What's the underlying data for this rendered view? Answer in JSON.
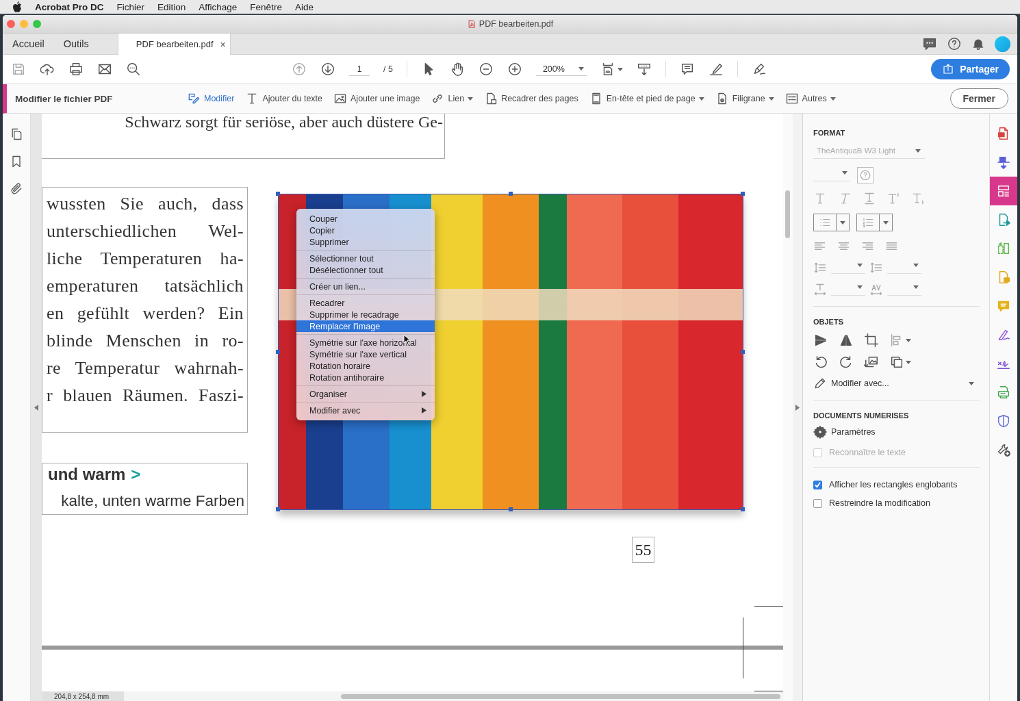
{
  "menubar": {
    "app": "Acrobat Pro DC",
    "items": [
      "Fichier",
      "Edition",
      "Affichage",
      "Fenêtre",
      "Aide"
    ]
  },
  "window": {
    "title": "PDF bearbeiten.pdf"
  },
  "tabs": [
    {
      "label": "Accueil",
      "selected": false
    },
    {
      "label": "Outils",
      "selected": false
    },
    {
      "label": "PDF bearbeiten.pdf",
      "selected": true,
      "close": "×"
    }
  ],
  "toolbar": {
    "page_current": "1",
    "page_total": "/ 5",
    "zoom": "200%",
    "share": "Partager"
  },
  "edit_bar": {
    "title": "Modifier le fichier PDF",
    "close": "Fermer",
    "tools": [
      {
        "label": "Modifier",
        "selected": true,
        "dropdown": false
      },
      {
        "label": "Ajouter du texte",
        "selected": false,
        "dropdown": false
      },
      {
        "label": "Ajouter une image",
        "selected": false,
        "dropdown": false
      },
      {
        "label": "Lien",
        "selected": false,
        "dropdown": true
      },
      {
        "label": "Recadrer des pages",
        "selected": false,
        "dropdown": false
      },
      {
        "label": "En-tête et pied de page",
        "selected": false,
        "dropdown": true
      },
      {
        "label": "Filigrane",
        "selected": false,
        "dropdown": true
      },
      {
        "label": "Autres",
        "selected": false,
        "dropdown": true
      }
    ]
  },
  "document": {
    "top_line": "Schwarz sorgt für seriöse, aber auch düstere Ge-",
    "paragraph_lines": [
      "wussten Sie auch, dass",
      "unterschiedlichen Wel-",
      "liche Temperaturen ha-",
      "emperaturen tatsächlich",
      "en gefühlt werden? Ein",
      "blinde Menschen in ro-",
      "re Temperatur wahrnah-",
      "r blauen Räumen. Faszi-"
    ],
    "heading": "und warm",
    "heading_arrow": ">",
    "subline": "kalte, unten warme Farben",
    "page_number": "55",
    "dimensions": "204,8 x 254,8 mm"
  },
  "context_menu": {
    "groups": [
      {
        "items": [
          {
            "label": "Couper",
            "selected": false,
            "submenu": false
          },
          {
            "label": "Copier",
            "selected": false,
            "submenu": false
          },
          {
            "label": "Supprimer",
            "selected": false,
            "submenu": false
          }
        ]
      },
      {
        "items": [
          {
            "label": "Sélectionner tout",
            "selected": false,
            "submenu": false
          },
          {
            "label": "Désélectionner tout",
            "selected": false,
            "submenu": false
          }
        ]
      },
      {
        "items": [
          {
            "label": "Créer un lien...",
            "selected": false,
            "submenu": false
          }
        ]
      },
      {
        "items": [
          {
            "label": "Recadrer",
            "selected": false,
            "submenu": false
          },
          {
            "label": "Supprimer le recadrage",
            "selected": false,
            "submenu": false
          },
          {
            "label": "Remplacer l'image",
            "selected": true,
            "submenu": false
          }
        ]
      },
      {
        "items": [
          {
            "label": "Symétrie sur l'axe horizontal",
            "selected": false,
            "submenu": false
          },
          {
            "label": "Symétrie sur l'axe vertical",
            "selected": false,
            "submenu": false
          },
          {
            "label": "Rotation horaire",
            "selected": false,
            "submenu": false
          },
          {
            "label": "Rotation antihoraire",
            "selected": false,
            "submenu": false
          }
        ]
      },
      {
        "items": [
          {
            "label": "Organiser",
            "selected": false,
            "submenu": true
          }
        ]
      },
      {
        "items": [
          {
            "label": "Modifier avec",
            "selected": false,
            "submenu": true
          }
        ]
      }
    ]
  },
  "format_panel": {
    "format_heading": "FORMAT",
    "font": "TheAntiquaB W3 Light",
    "objects_heading": "OBJETS",
    "edit_with": "Modifier avec...",
    "scanned_heading": "DOCUMENTS NUMERISES",
    "settings": "Paramètres",
    "checkboxes": [
      {
        "label": "Reconnaître le texte",
        "checked": false,
        "disabled": true
      },
      {
        "label": "Afficher les rectangles englobants",
        "checked": true,
        "disabled": false
      },
      {
        "label": "Restreindre la modification",
        "checked": false,
        "disabled": false
      }
    ]
  },
  "tool_rail": [
    {
      "selected": false,
      "color": "#d9433f"
    },
    {
      "selected": false,
      "color": "#5a5fd6"
    },
    {
      "selected": true,
      "color": "#d8388b"
    },
    {
      "selected": false,
      "color": "#1f9a9a"
    },
    {
      "selected": false,
      "color": "#5cb648"
    },
    {
      "selected": false,
      "color": "#e3a81c"
    },
    {
      "selected": false,
      "color": "#e3b21c"
    },
    {
      "selected": false,
      "color": "#8b55d6"
    },
    {
      "selected": false,
      "color": "#7a4fd0"
    },
    {
      "selected": false,
      "color": "#3fa64a"
    },
    {
      "selected": false,
      "color": "#6670d8"
    },
    {
      "selected": false,
      "color": "#555555"
    }
  ]
}
